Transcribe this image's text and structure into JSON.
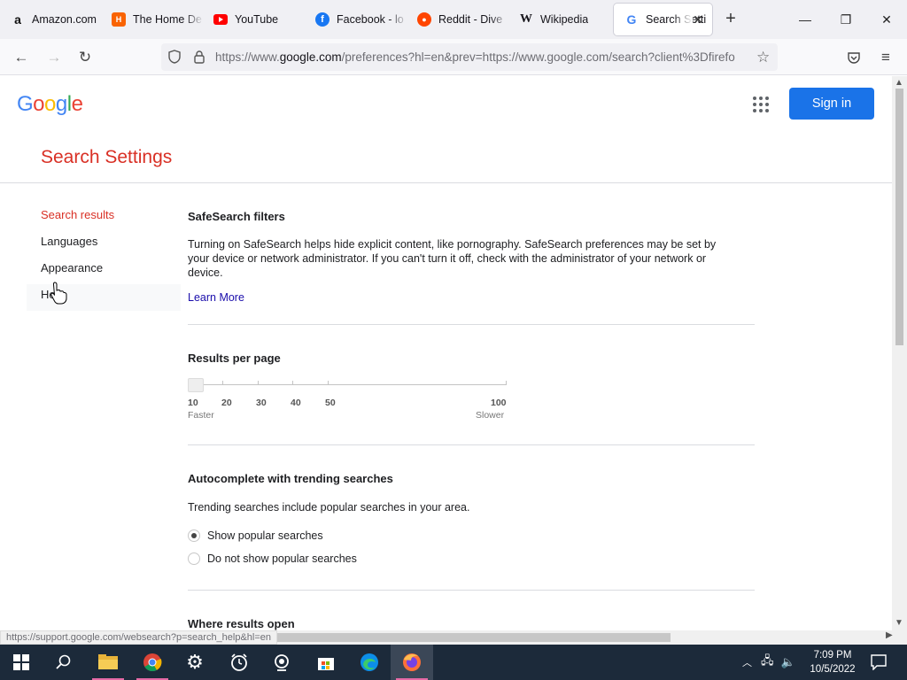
{
  "tabs": [
    {
      "label": "Amazon.com",
      "icon": "amazon-icon"
    },
    {
      "label": "The Home De",
      "icon": "home-depot-icon"
    },
    {
      "label": "YouTube",
      "icon": "youtube-icon"
    },
    {
      "label": "Facebook - lo",
      "icon": "facebook-icon"
    },
    {
      "label": "Reddit - Dive",
      "icon": "reddit-icon"
    },
    {
      "label": "Wikipedia",
      "icon": "wikipedia-icon"
    },
    {
      "label": "Search Setti",
      "icon": "google-icon",
      "active": true
    }
  ],
  "url": {
    "full": "https://www.google.com/preferences?hl=en&prev=https://www.google.com/search?client%3Dfirefo",
    "prefix": "https://www.",
    "host": "google.com",
    "rest": "/preferences?hl=en&prev=https://www.google.com/search?client%3Dfirefo"
  },
  "header": {
    "logo_letters": [
      "G",
      "o",
      "o",
      "g",
      "l",
      "e"
    ],
    "logo_colors": [
      "#4285f4",
      "#ea4335",
      "#fbbc05",
      "#4285f4",
      "#34a853",
      "#ea4335"
    ],
    "sign_in": "Sign in",
    "page_title": "Search Settings"
  },
  "sidebar": {
    "items": [
      {
        "label": "Search results",
        "active": true
      },
      {
        "label": "Languages"
      },
      {
        "label": "Appearance"
      },
      {
        "label": "He",
        "hover": true
      }
    ]
  },
  "safesearch": {
    "title": "SafeSearch filters",
    "text": "Turning on SafeSearch helps hide explicit content, like pornography. SafeSearch preferences may be set by your device or network administrator. If you can't turn it off, check with the administrator of your network or device.",
    "link": "Learn More"
  },
  "results_per_page": {
    "title": "Results per page",
    "value": 10,
    "ticks": [
      "10",
      "20",
      "30",
      "40",
      "50",
      "100"
    ],
    "left_caption": "Faster",
    "right_caption": "Slower"
  },
  "autocomplete": {
    "title": "Autocomplete with trending searches",
    "text": "Trending searches include popular searches in your area.",
    "options": [
      {
        "label": "Show popular searches",
        "selected": true
      },
      {
        "label": "Do not show popular searches",
        "selected": false
      }
    ]
  },
  "where_results_open": {
    "title": "Where results open"
  },
  "status_url": "https://support.google.com/websearch?p=search_help&hl=en",
  "clock": {
    "time": "7:09 PM",
    "date": "10/5/2022"
  },
  "colors": {
    "accent_red": "#d93025",
    "sign_in_blue": "#1a73e8",
    "link_blue": "#1a0dab"
  }
}
